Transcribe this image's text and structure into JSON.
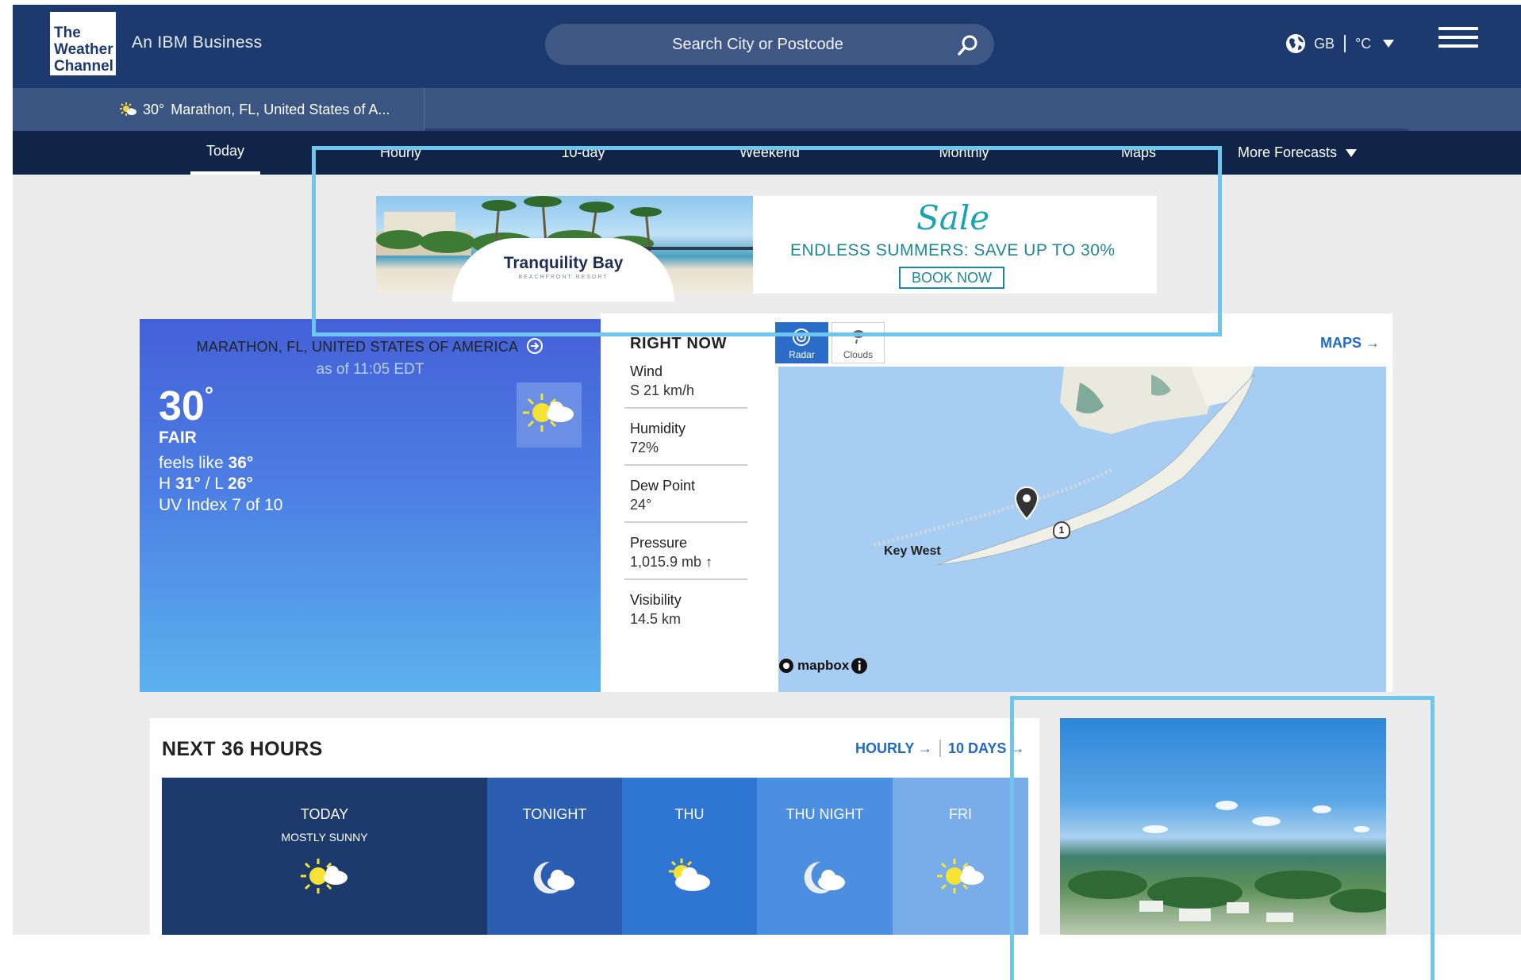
{
  "header": {
    "logo_line1": "The",
    "logo_line2": "Weather",
    "logo_line3": "Channel",
    "tagline": "An IBM Business",
    "search_placeholder": "Search City or Postcode",
    "region": "GB",
    "unit": "°C",
    "icons": [
      "search-icon",
      "globe-icon",
      "chevron-down-icon",
      "hamburger-menu-icon"
    ]
  },
  "recent_location": {
    "temp": "30°",
    "name": "Marathon, FL, United States of A..."
  },
  "nav": {
    "tabs": [
      "Today",
      "Hourly",
      "10-day",
      "Weekend",
      "Monthly",
      "Maps"
    ],
    "more": "More Forecasts",
    "active": "Today"
  },
  "ad": {
    "brand": "Tranquility Bay",
    "brand_sub": "BEACHFRONT RESORT",
    "sale": "Sale",
    "headline": "ENDLESS SUMMERS: SAVE UP TO 30%",
    "cta": "BOOK NOW"
  },
  "current": {
    "location": "MARATHON, FL, UNITED STATES OF AMERICA",
    "as_of": "as of 11:05 EDT",
    "temp": "30",
    "degree": "°",
    "condition": "FAIR",
    "feels_like_label": "feels like ",
    "feels_like_value": "36°",
    "hilo_h_label": "H ",
    "hilo_h": "31°",
    "hilo_sep": " / L ",
    "hilo_l": "26°",
    "uv": "UV Index 7 of 10",
    "icon": "mostly-sunny-icon"
  },
  "right_now": {
    "title": "RIGHT NOW",
    "items": [
      {
        "label": "Wind",
        "value": "S 21 km/h"
      },
      {
        "label": "Humidity",
        "value": "72%"
      },
      {
        "label": "Dew Point",
        "value": "24°"
      },
      {
        "label": "Pressure",
        "value": "1,015.9 mb ↑"
      },
      {
        "label": "Visibility",
        "value": "14.5 km"
      }
    ]
  },
  "map": {
    "tabs": [
      "Radar",
      "Clouds"
    ],
    "active_tab": "Radar",
    "link": "MAPS →",
    "place_label": "Key West",
    "attribution": "mapbox",
    "route_marker": "1"
  },
  "next36": {
    "title": "NEXT 36 HOURS",
    "hourly_link": "HOURLY →",
    "tendays_link": "10 DAYS →",
    "slots": [
      {
        "name": "TODAY",
        "sub": "MOSTLY SUNNY",
        "icon": "mostly-sunny-icon"
      },
      {
        "name": "TONIGHT",
        "sub": "",
        "icon": "partly-cloudy-night-icon"
      },
      {
        "name": "THU",
        "sub": "",
        "icon": "partly-cloudy-icon"
      },
      {
        "name": "THU NIGHT",
        "sub": "",
        "icon": "partly-cloudy-night-icon"
      },
      {
        "name": "FRI",
        "sub": "",
        "icon": "mostly-sunny-icon"
      }
    ]
  },
  "colors": {
    "header": "#1c3a6e",
    "nav": "#0f2447",
    "accent_link": "#1f6ac9",
    "highlight_outline": "#6ec5ee"
  }
}
